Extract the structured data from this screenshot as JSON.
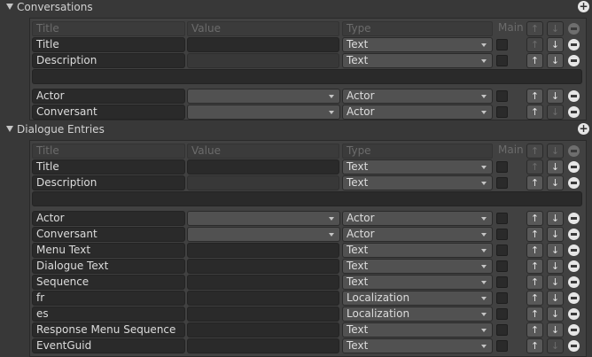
{
  "sections": [
    {
      "title": "Conversations",
      "header": {
        "title": "Title",
        "value": "Value",
        "type": "Type",
        "main": "Main"
      },
      "rows_top": [
        {
          "title": "Title",
          "type": "Text"
        },
        {
          "title": "Description",
          "type": "Text"
        }
      ],
      "rows_bottom": [
        {
          "title": "Actor",
          "type": "Actor"
        },
        {
          "title": "Conversant",
          "type": "Actor"
        }
      ]
    },
    {
      "title": "Dialogue Entries",
      "header": {
        "title": "Title",
        "value": "Value",
        "type": "Type",
        "main": "Main"
      },
      "rows_top": [
        {
          "title": "Title",
          "type": "Text"
        },
        {
          "title": "Description",
          "type": "Text"
        }
      ],
      "rows_bottom": [
        {
          "title": "Actor",
          "type": "Actor"
        },
        {
          "title": "Conversant",
          "type": "Actor"
        },
        {
          "title": "Menu Text",
          "type": "Text"
        },
        {
          "title": "Dialogue Text",
          "type": "Text"
        },
        {
          "title": "Sequence",
          "type": "Text"
        },
        {
          "title": "fr",
          "type": "Localization"
        },
        {
          "title": "es",
          "type": "Localization"
        },
        {
          "title": "Response Menu Sequence",
          "type": "Text"
        },
        {
          "title": "EventGuid",
          "type": "Text"
        }
      ]
    }
  ],
  "icons": {
    "add": "+",
    "up": "↑",
    "down": "↓"
  }
}
